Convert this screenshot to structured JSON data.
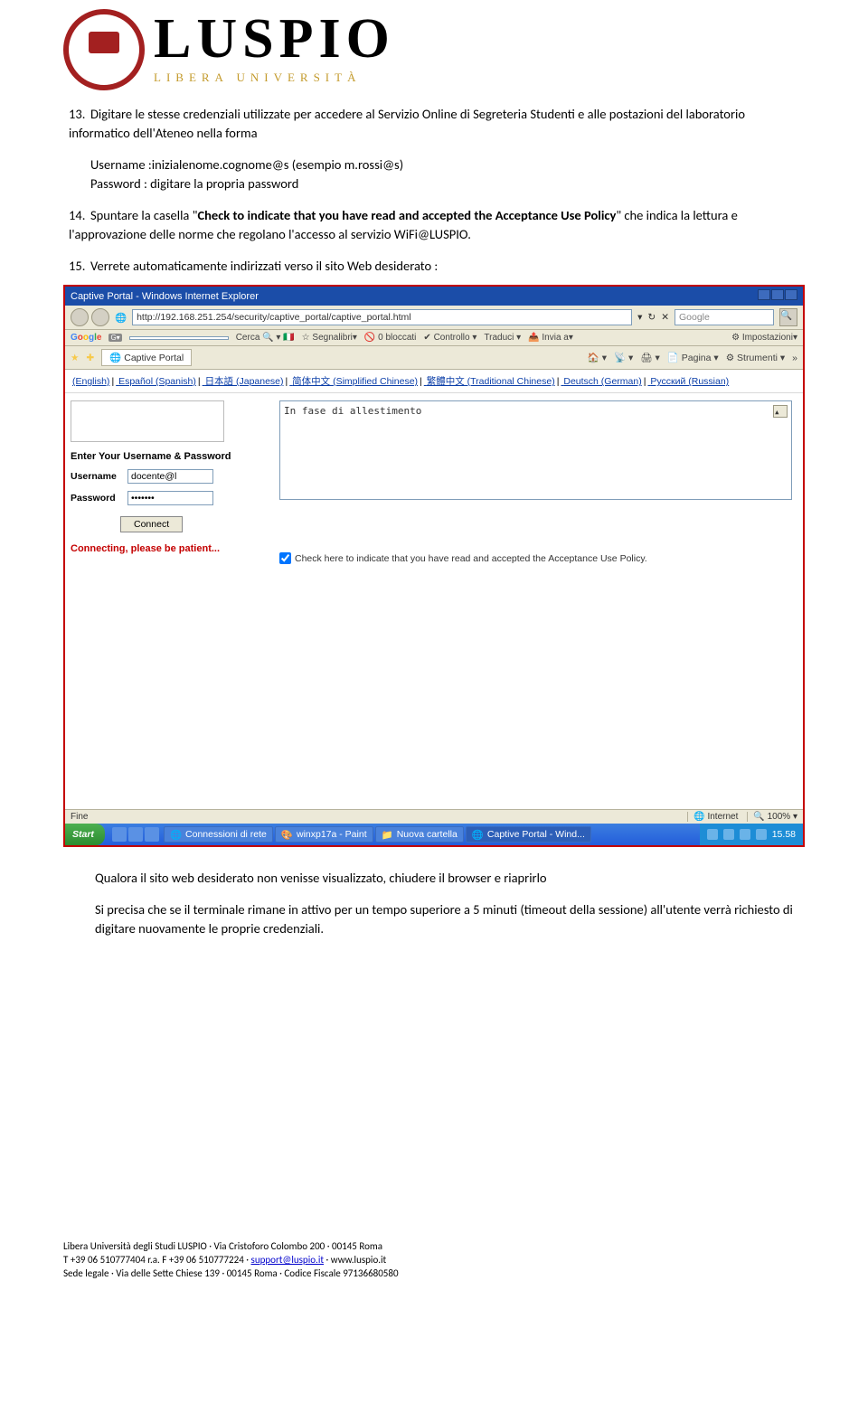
{
  "header": {
    "logoMain": "LUSPIO",
    "logoSub": "LIBERA UNIVERSITÀ"
  },
  "items": {
    "i13": {
      "num": "13.",
      "text": "Digitare le stesse credenziali utilizzate per accedere al Servizio Online di Segreteria Studenti e alle postazioni del laboratorio informatico dell'Ateneo nella forma"
    },
    "sub1line1": "Username :inizialenome.cognome@s (esempio m.rossi@s)",
    "sub1line2": "Password : digitare la propria password",
    "i14": {
      "num": "14.",
      "text_pre": "Spuntare la casella \"",
      "bold": "Check to indicate that you have read and accepted the Acceptance Use Policy",
      "text_post": "\" che indica la lettura e l'approvazione delle norme che regolano l'accesso al servizio WiFi@LUSPIO."
    },
    "i15": {
      "num": "15.",
      "text": "Verrete automaticamente indirizzati verso il sito Web desiderato :"
    }
  },
  "screenshot": {
    "title": "Captive Portal - Windows Internet Explorer",
    "url": "http://192.168.251.254/security/captive_portal/captive_portal.html",
    "searchProvider": "Google",
    "google": {
      "cerca": "Cerca",
      "segnalibri": "Segnalibri▾",
      "bloccati": "0 bloccati",
      "controllo": "Controllo ▾",
      "traduci": "Traduci ▾",
      "invia": "Invia a▾",
      "impostazioni": "Impostazioni▾"
    },
    "favorites": {
      "tab": "Captive Portal",
      "home": "▾",
      "rss": "▾",
      "pagina": "Pagina ▾",
      "strumenti": "Strumenti ▾"
    },
    "languages": {
      "en": "(English)",
      "es": "Español (Spanish)",
      "ja": "日本語 (Japanese)",
      "zhs": "简体中文 (Simplified Chinese)",
      "zht": "繁體中文 (Traditional Chinese)",
      "de": "Deutsch (German)",
      "ru": "Русский (Russian)"
    },
    "login": {
      "title": "Enter Your Username & Password",
      "userLabel": "Username",
      "userValue": "docente@l",
      "passLabel": "Password",
      "passValue": "•••••••",
      "connect": "Connect",
      "connecting": "Connecting, please be patient..."
    },
    "main": {
      "text": "In fase di allestimento",
      "aup": "Check here to indicate that you have read and accepted the Acceptance Use Policy."
    },
    "statusbar": {
      "left": "Fine",
      "internet": "Internet",
      "zoom": "100%"
    },
    "taskbar": {
      "start": "Start",
      "t1": "Connessioni di rete",
      "t2": "winxp17a - Paint",
      "t3": "Nuova cartella",
      "t4": "Captive Portal - Wind...",
      "clock": "15.58"
    }
  },
  "closing": {
    "p1": "Qualora il sito web desiderato non venisse visualizzato, chiudere il browser e riaprirlo",
    "p2": "Si precisa che se il terminale rimane in attivo per un tempo superiore a 5 minuti (timeout della sessione) all'utente verrà richiesto di digitare nuovamente le proprie credenziali."
  },
  "footer": {
    "line1": "Libera Università degli Studi LUSPIO · Via Cristoforo Colombo 200 · 00145 Roma",
    "line2_pre": "T +39 06 510777404 r.a. F +39 06 510777224 · ",
    "email": "support@luspio.it",
    "site_sep": " · ",
    "line2_site": "www.luspio.it",
    "line3": "Sede legale · Via delle Sette Chiese 139 · 00145 Roma · Codice Fiscale 97136680580"
  }
}
